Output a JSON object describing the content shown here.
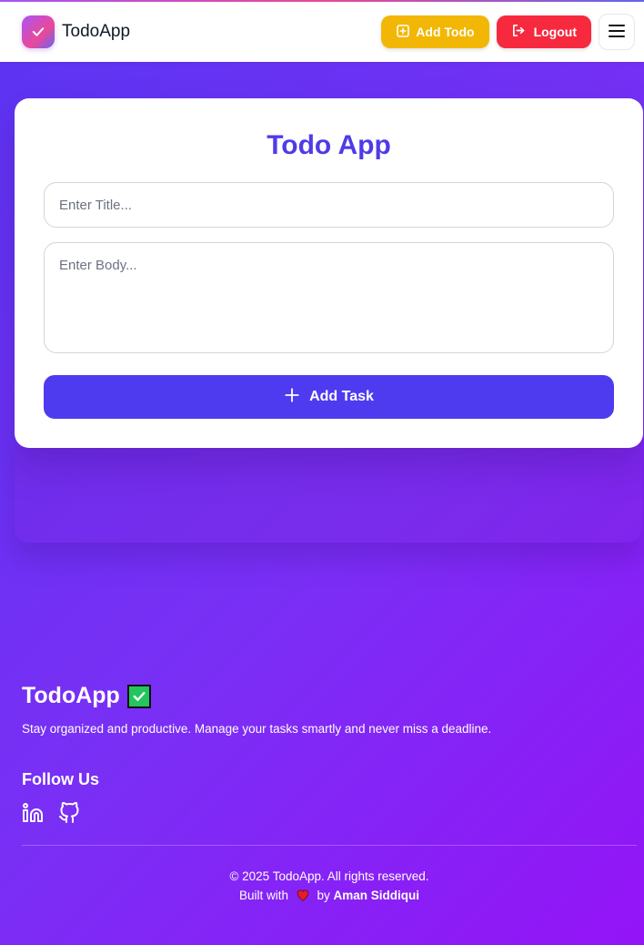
{
  "navbar": {
    "brand_name": "TodoApp",
    "add_todo_label": "Add Todo",
    "logout_label": "Logout"
  },
  "form": {
    "heading": "Todo App",
    "title_placeholder": "Enter Title...",
    "body_placeholder": "Enter Body...",
    "submit_label": "Add Task"
  },
  "footer": {
    "brand_name": "TodoApp",
    "tagline": "Stay organized and productive. Manage your tasks smartly and never miss a deadline.",
    "follow_heading": "Follow Us",
    "social_links": [
      "linkedin-icon",
      "github-icon"
    ],
    "copyright": "© 2025 TodoApp. All rights reserved.",
    "built_with_prefix": "Built with",
    "built_with_by": "by",
    "author": "Aman Siddiqui"
  },
  "colors": {
    "accent": "#4f3bef",
    "add_todo": "#f2b705",
    "logout": "#f6293f",
    "background_start": "#5b35f2",
    "background_end": "#9414f7"
  }
}
